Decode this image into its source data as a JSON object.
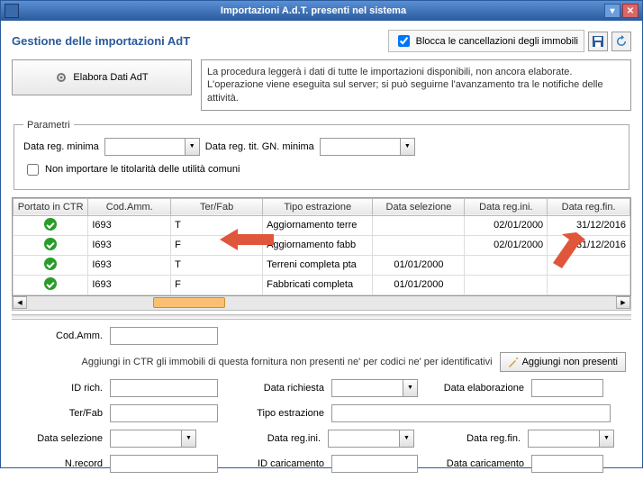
{
  "window": {
    "title": "Importazioni A.d.T. presenti nel sistema"
  },
  "header": {
    "subtitle": "Gestione delle importazioni AdT",
    "block_checkbox_label": "Blocca le cancellazioni degli immobili",
    "block_checked": true
  },
  "elab": {
    "button": "Elabora Dati AdT",
    "description": "La procedura leggerà i dati di tutte le importazioni disponibili, non ancora elaborate. L'operazione viene eseguita sul server; si può seguirne l'avanzamento tra le notifiche delle attività."
  },
  "params": {
    "legend": "Parametri",
    "min_date_label": "Data reg. minima",
    "min_date_tit_label": "Data reg. tit. GN. minima",
    "no_import_label": "Non importare le titolarità delle utilità comuni",
    "min_date": "",
    "min_date_tit": ""
  },
  "table": {
    "cols": [
      "Portato in CTR",
      "Cod.Amm.",
      "Ter/Fab",
      "Tipo estrazione",
      "Data selezione",
      "Data reg.ini.",
      "Data reg.fin."
    ],
    "rows": [
      {
        "ok": true,
        "cod": "I693",
        "tf": "T",
        "tipo": "Aggiornamento terre",
        "sel": "",
        "ini": "02/01/2000",
        "fin": "31/12/2016"
      },
      {
        "ok": true,
        "cod": "I693",
        "tf": "F",
        "tipo": "Aggiornamento fabb",
        "sel": "",
        "ini": "02/01/2000",
        "fin": "31/12/2016"
      },
      {
        "ok": true,
        "cod": "I693",
        "tf": "T",
        "tipo": "Terreni completa pta",
        "sel": "01/01/2000",
        "ini": "",
        "fin": ""
      },
      {
        "ok": true,
        "cod": "I693",
        "tf": "F",
        "tipo": "Fabbricati completa",
        "sel": "01/01/2000",
        "ini": "",
        "fin": ""
      }
    ]
  },
  "form": {
    "cod_amm_label": "Cod.Amm.",
    "aggiungi_hint": "Aggiungi in CTR gli immobili di questa fornitura non presenti ne' per codici ne' per identificativi",
    "aggiungi_btn": "Aggiungi non presenti",
    "id_rich_label": "ID rich.",
    "data_richiesta_label": "Data richiesta",
    "data_elab_label": "Data elaborazione",
    "terfab_label": "Ter/Fab",
    "tipo_estr_label": "Tipo estrazione",
    "data_sel_label": "Data selezione",
    "data_reg_ini_label": "Data reg.ini.",
    "data_reg_fin_label": "Data reg.fin.",
    "n_record_label": "N.record",
    "id_caric_label": "ID caricamento",
    "data_caric_label": "Data caricamento"
  }
}
